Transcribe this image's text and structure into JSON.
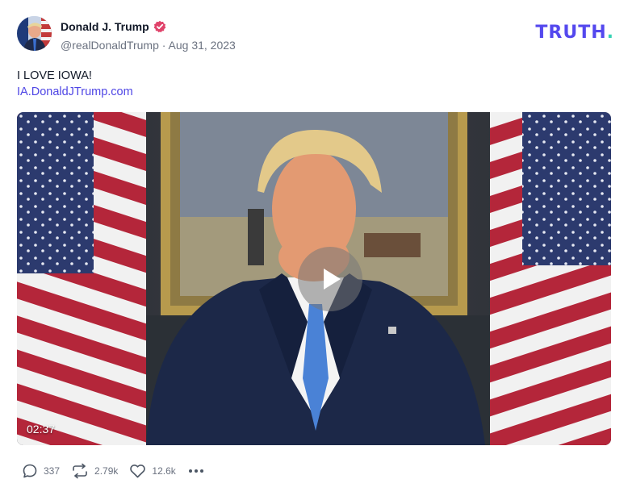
{
  "post": {
    "author_name": "Donald J. Trump",
    "handle": "@realDonaldTrump",
    "date": "Aug 31, 2023",
    "text": "I LOVE IOWA!",
    "link_text": "IA.DonaldJTrump.com"
  },
  "brand": {
    "name": "TRUTH",
    "dot": ".",
    "color": "#5448ee",
    "dot_color": "#36d3b4"
  },
  "video": {
    "duration": "02:37"
  },
  "actions": {
    "replies": "337",
    "retruths": "2.79k",
    "likes": "12.6k"
  },
  "icons": {
    "verified": "verified-badge-icon",
    "reply": "speech-bubble-icon",
    "retruth": "repost-arrows-icon",
    "like": "heart-icon",
    "more": "ellipsis-icon",
    "play": "play-icon"
  }
}
